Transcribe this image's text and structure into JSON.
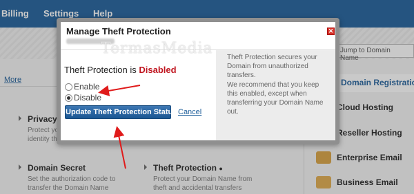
{
  "nav": {
    "billing": "Billing",
    "settings": "Settings",
    "help": "Help"
  },
  "page": {
    "more_link": "More",
    "features": [
      {
        "title": "Privacy",
        "desc": "Protect your\nidentity th"
      },
      {
        "title": "Domain Secret",
        "desc": "Set the authorization code to\ntransfer the Domain Name"
      },
      {
        "title": "Theft Protection",
        "desc": "Protect your Domain Name from\ntheft and accidental transfers"
      }
    ]
  },
  "sidebar": {
    "jump_placeholder": "Jump to Domain Name",
    "items": [
      {
        "label": "Domain Registration",
        "color": "#1d5e9a"
      },
      {
        "label": "Cloud Hosting",
        "color": "#222222"
      },
      {
        "label": "Reseller Hosting",
        "color": "#222222"
      },
      {
        "label": "Enterprise Email",
        "color": "#222222"
      },
      {
        "label": "Business Email",
        "color": "#222222"
      }
    ]
  },
  "modal": {
    "title": "Manage Theft Protection",
    "status_prefix": "Theft Protection is",
    "status_value": "Disabled",
    "options": [
      {
        "label": "Enable",
        "checked": false
      },
      {
        "label": "Disable",
        "checked": true
      }
    ],
    "update_button": "Update Theft Protection Status",
    "cancel_link": "Cancel",
    "info_1": "Theft Protection secures your Domain from unauthorized transfers.",
    "info_2": "We recommend that you keep this enabled, except when transferring your Domain Name out.",
    "close_label": "✕"
  },
  "watermark": "TermasMedia",
  "colors": {
    "accent": "#1d5e9a",
    "danger": "#c0151f",
    "annotation": "#e01b1b"
  }
}
